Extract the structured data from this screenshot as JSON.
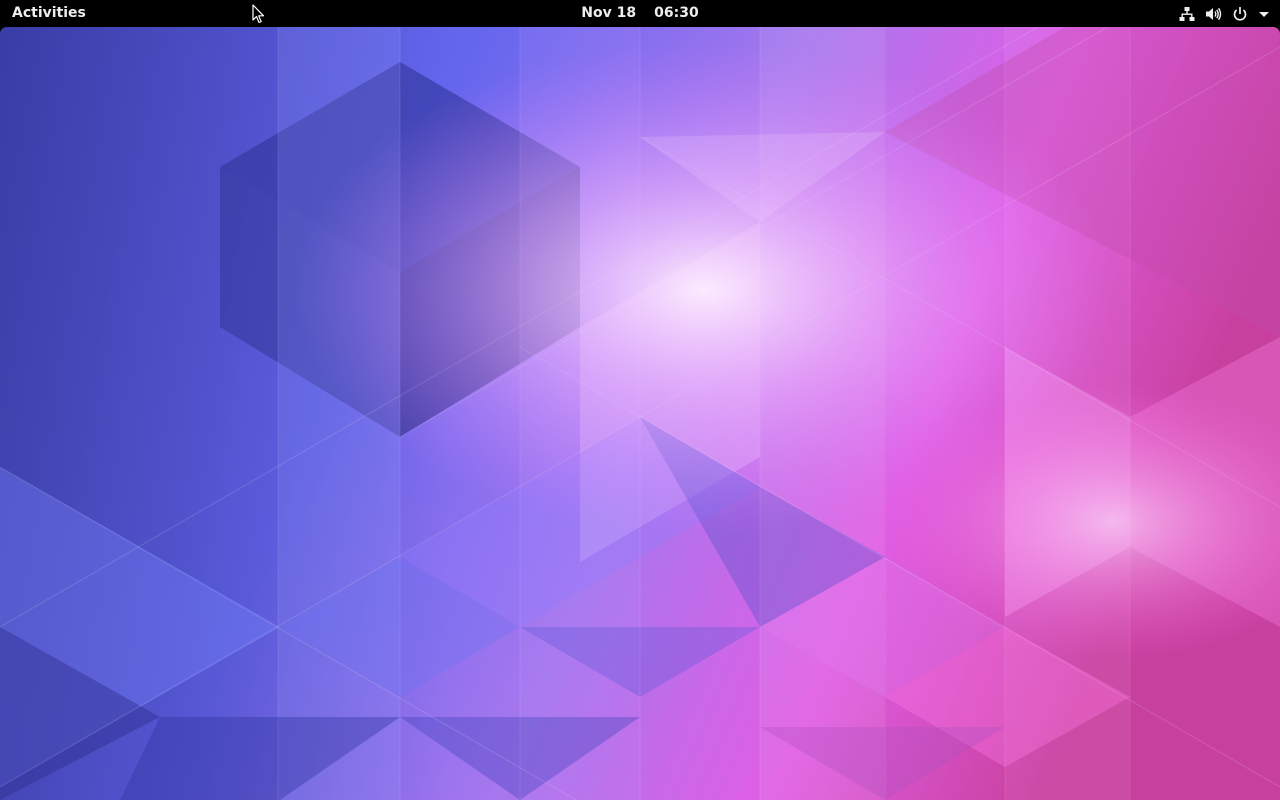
{
  "topbar": {
    "activities_label": "Activities",
    "date": "Nov 18",
    "time": "06:30"
  },
  "status_icons": [
    "network-wired-icon",
    "volume-icon",
    "power-icon",
    "chevron-down-icon"
  ],
  "colors": {
    "panel_bg": "#000000",
    "panel_text": "#eeeeec",
    "wallpaper_blue": "#5c5ef0",
    "wallpaper_magenta": "#f04fe6",
    "wallpaper_highlight": "#ffe8ff"
  }
}
